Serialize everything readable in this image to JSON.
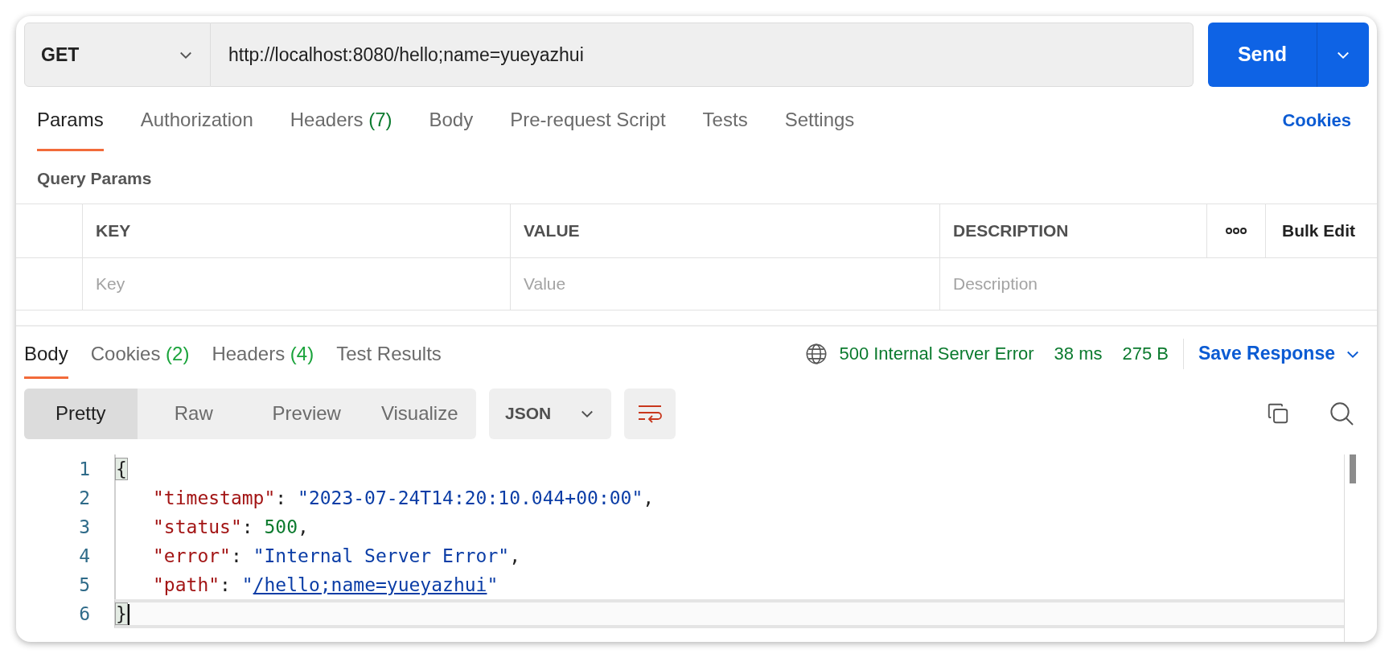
{
  "request": {
    "method": "GET",
    "url": "http://localhost:8080/hello;name=yueyazhui",
    "send_label": "Send"
  },
  "request_tabs": [
    {
      "label": "Params",
      "selected": true
    },
    {
      "label": "Authorization",
      "selected": false
    },
    {
      "label": "Headers",
      "count": "(7)",
      "selected": false
    },
    {
      "label": "Body",
      "selected": false
    },
    {
      "label": "Pre-request Script",
      "selected": false
    },
    {
      "label": "Tests",
      "selected": false
    },
    {
      "label": "Settings",
      "selected": false
    }
  ],
  "cookies_link": "Cookies",
  "section_title": "Query Params",
  "params_table": {
    "columns": [
      "KEY",
      "VALUE",
      "DESCRIPTION"
    ],
    "bulk_edit": "Bulk Edit",
    "placeholders": [
      "Key",
      "Value",
      "Description"
    ]
  },
  "response_tabs": [
    {
      "label": "Body",
      "selected": true
    },
    {
      "label": "Cookies",
      "count": "(2)",
      "selected": false
    },
    {
      "label": "Headers",
      "count": "(4)",
      "selected": false
    },
    {
      "label": "Test Results",
      "selected": false
    }
  ],
  "response_status": {
    "status": "500 Internal Server Error",
    "time": "38 ms",
    "size": "275 B",
    "save_label": "Save Response"
  },
  "view_modes": [
    {
      "label": "Pretty",
      "selected": true
    },
    {
      "label": "Raw",
      "selected": false
    },
    {
      "label": "Preview",
      "selected": false
    },
    {
      "label": "Visualize",
      "selected": false
    }
  ],
  "format": "JSON",
  "code_lines": [
    {
      "number": "1",
      "active": false,
      "indented": false,
      "tokens": [
        {
          "kind": "bracket",
          "text": "{"
        }
      ]
    },
    {
      "number": "2",
      "active": false,
      "indented": true,
      "tokens": [
        {
          "kind": "key",
          "text": "\"timestamp\""
        },
        {
          "kind": "punct",
          "text": ": "
        },
        {
          "kind": "string",
          "text": "\"2023-07-24T14:20:10.044+00:00\""
        },
        {
          "kind": "punct",
          "text": ","
        }
      ]
    },
    {
      "number": "3",
      "active": false,
      "indented": true,
      "tokens": [
        {
          "kind": "key",
          "text": "\"status\""
        },
        {
          "kind": "punct",
          "text": ": "
        },
        {
          "kind": "number",
          "text": "500"
        },
        {
          "kind": "punct",
          "text": ","
        }
      ]
    },
    {
      "number": "4",
      "active": false,
      "indented": true,
      "tokens": [
        {
          "kind": "key",
          "text": "\"error\""
        },
        {
          "kind": "punct",
          "text": ": "
        },
        {
          "kind": "string",
          "text": "\"Internal Server Error\""
        },
        {
          "kind": "punct",
          "text": ","
        }
      ]
    },
    {
      "number": "5",
      "active": false,
      "indented": true,
      "tokens": [
        {
          "kind": "key",
          "text": "\"path\""
        },
        {
          "kind": "punct",
          "text": ": "
        },
        {
          "kind": "string",
          "text": "\""
        },
        {
          "kind": "link",
          "text": "/hello;name=yueyazhui"
        },
        {
          "kind": "string",
          "text": "\""
        }
      ]
    },
    {
      "number": "6",
      "active": true,
      "indented": false,
      "tokens": [
        {
          "kind": "bracket",
          "text": "}"
        }
      ]
    }
  ]
}
